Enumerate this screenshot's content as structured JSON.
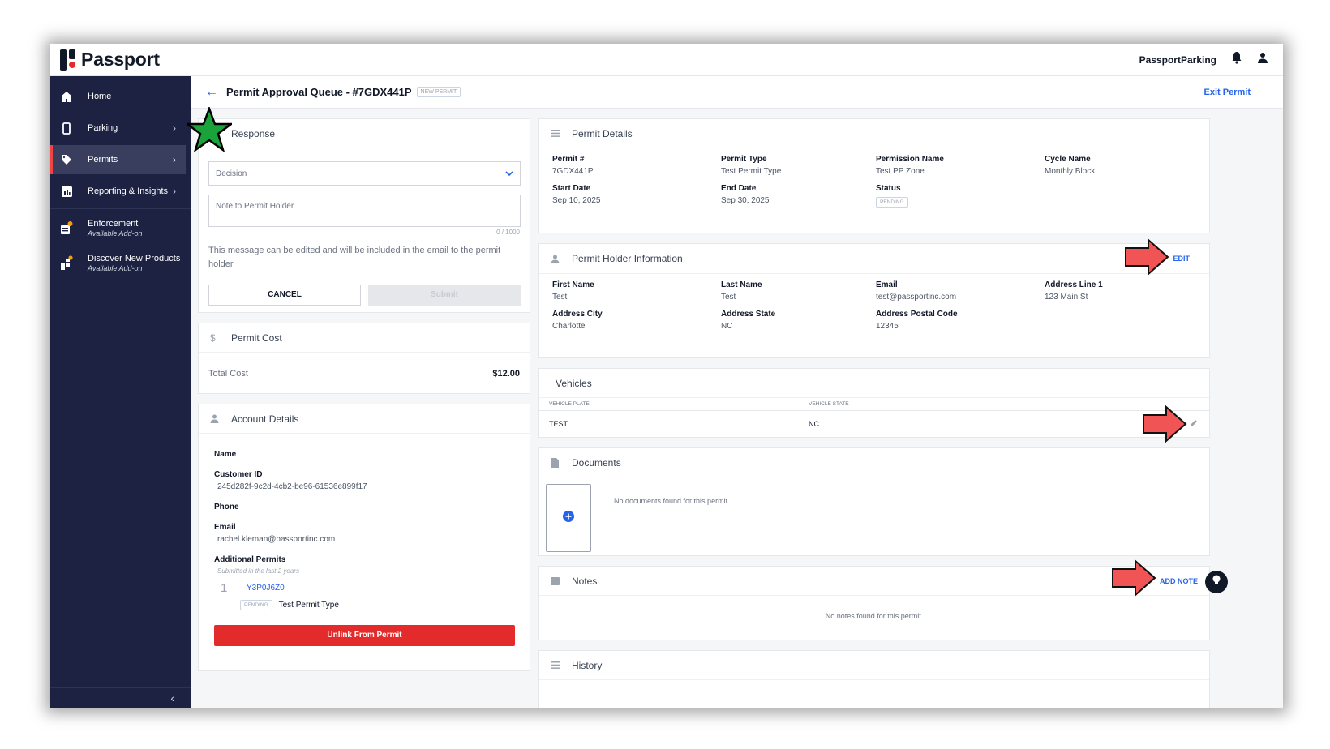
{
  "app": {
    "brand": "Passport",
    "org": "PassportParking"
  },
  "sidebar": {
    "items": [
      {
        "label": "Home"
      },
      {
        "label": "Parking"
      },
      {
        "label": "Permits"
      },
      {
        "label": "Reporting & Insights"
      },
      {
        "label": "Enforcement",
        "sub": "Available Add-on"
      },
      {
        "label": "Discover New Products",
        "sub": "Available Add-on"
      }
    ]
  },
  "header": {
    "title": "Permit Approval Queue - #7GDX441P",
    "badge": "NEW PERMIT",
    "exit": "Exit Permit"
  },
  "response": {
    "title": "Response",
    "decision_placeholder": "Decision",
    "note_placeholder": "Note to Permit Holder",
    "counter": "0 / 1000",
    "help": "This message can be edited and will be included in the email to the permit holder.",
    "cancel": "CANCEL",
    "submit": "Submit"
  },
  "cost": {
    "title": "Permit Cost",
    "label": "Total Cost",
    "value": "$12.00"
  },
  "account": {
    "title": "Account Details",
    "name_label": "Name",
    "customer_id_label": "Customer ID",
    "customer_id": "245d282f-9c2d-4cb2-be96-61536e899f17",
    "phone_label": "Phone",
    "email_label": "Email",
    "email": "rachel.kleman@passportinc.com",
    "additional_label": "Additional Permits",
    "additional_sub": "Submitted in the last 2 years",
    "permit_index": "1",
    "permit_link": "Y3P0J6Z0",
    "permit_status": "PENDING",
    "permit_type": "Test Permit Type",
    "unlink": "Unlink From Permit"
  },
  "permit_details": {
    "title": "Permit Details",
    "permit_label": "Permit #",
    "permit": "7GDX441P",
    "type_label": "Permit Type",
    "type": "Test Permit Type",
    "permission_label": "Permission Name",
    "permission": "Test PP Zone",
    "cycle_label": "Cycle Name",
    "cycle": "Monthly Block",
    "start_label": "Start Date",
    "start": "Sep 10, 2025",
    "end_label": "End Date",
    "end": "Sep 30, 2025",
    "status_label": "Status",
    "status": "PENDING"
  },
  "holder": {
    "title": "Permit Holder Information",
    "edit": "EDIT",
    "first_label": "First Name",
    "first": "Test",
    "last_label": "Last Name",
    "last": "Test",
    "email_label": "Email",
    "email": "test@passportinc.com",
    "addr1_label": "Address Line 1",
    "addr1": "123 Main St",
    "city_label": "Address City",
    "city": "Charlotte",
    "state_label": "Address State",
    "state": "NC",
    "postal_label": "Address Postal Code",
    "postal": "12345"
  },
  "vehicles": {
    "title": "Vehicles",
    "col_plate": "VEHICLE PLATE",
    "col_state": "VEHICLE STATE",
    "plate": "TEST",
    "state": "NC"
  },
  "documents": {
    "title": "Documents",
    "empty": "No documents found for this permit."
  },
  "notes": {
    "title": "Notes",
    "add": "ADD NOTE",
    "empty": "No notes found for this permit."
  },
  "history": {
    "title": "History"
  },
  "colors": {
    "navy": "#1d2142",
    "accent_red": "#e32b2b",
    "link_blue": "#2563eb",
    "arrow": "#f05454",
    "star": "#1aa33a"
  }
}
